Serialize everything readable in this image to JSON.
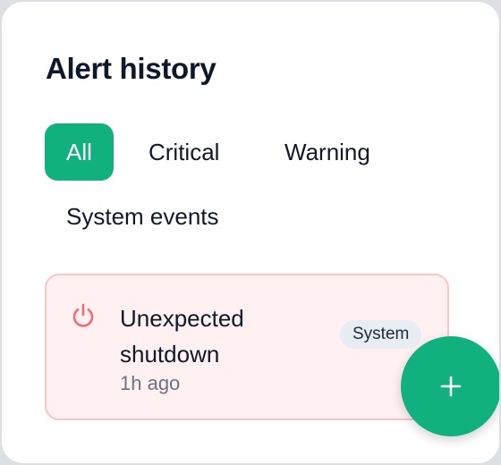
{
  "header": {
    "title": "Alert history"
  },
  "filters": [
    {
      "label": "All",
      "active": true
    },
    {
      "label": "Critical",
      "active": false
    },
    {
      "label": "Warning",
      "active": false
    },
    {
      "label": "System events",
      "active": false
    }
  ],
  "alerts": [
    {
      "icon": "power-icon",
      "title": "Unexpected shutdown",
      "time": "1h ago",
      "badge": "System",
      "accent_color": "#ef6b75"
    }
  ],
  "fab": {
    "icon": "plus-icon"
  },
  "colors": {
    "accent": "#10b07f",
    "alert_bg": "#fff1f2",
    "alert_border": "#fbc4c9"
  }
}
